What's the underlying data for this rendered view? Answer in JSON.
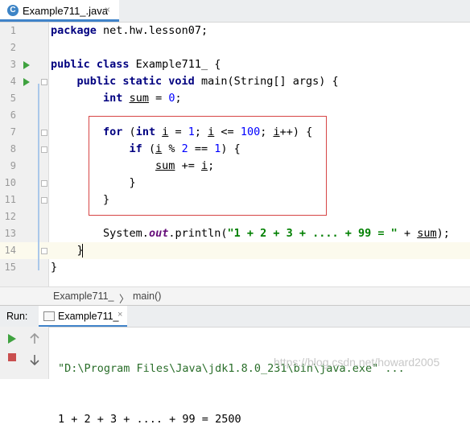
{
  "editor_tab": {
    "title": "Example711_.java",
    "icon": "C",
    "close": "×"
  },
  "editor": {
    "line_numbers": [
      "1",
      "2",
      "3",
      "4",
      "5",
      "6",
      "7",
      "8",
      "9",
      "10",
      "11",
      "12",
      "13",
      "14",
      "15"
    ],
    "code": {
      "l1_kw": "package",
      "l1_rest": " net.hw.lesson07;",
      "l3_kw": "public class",
      "l3_rest": " Example711_ {",
      "l4_kw": "public static void",
      "l4_rest": " main(String[] args) {",
      "l5_kw": "int",
      "l5_var": "sum",
      "l5_eq": " = ",
      "l5_num": "0",
      "l5_end": ";",
      "l7_for": "for",
      "l7_a": " (",
      "l7_int": "int",
      "l7_i1": "i",
      "l7_b": " = ",
      "l7_n1": "1",
      "l7_c": "; ",
      "l7_i2": "i",
      "l7_d": " <= ",
      "l7_n2": "100",
      "l7_e": "; ",
      "l7_i3": "i",
      "l7_f": "++) {",
      "l8_if": "if",
      "l8_a": " (",
      "l8_i": "i",
      "l8_b": " % ",
      "l8_n1": "2",
      "l8_c": " == ",
      "l8_n2": "1",
      "l8_d": ") {",
      "l9_sum": "sum",
      "l9_a": " += ",
      "l9_i": "i",
      "l9_b": ";",
      "l10": "}",
      "l11": "}",
      "l13_a": "System.",
      "l13_out": "out",
      "l13_b": ".println(",
      "l13_str": "\"1 + 2 + 3 + .... + 99 = \"",
      "l13_c": " + ",
      "l13_sum": "sum",
      "l13_d": ");",
      "l14": "}",
      "l15": "}"
    }
  },
  "breadcrumb": {
    "class": "Example711_",
    "sep": "〉",
    "method": "main()"
  },
  "run_panel": {
    "label": "Run:",
    "tab_title": "Example711_",
    "tab_close": "×",
    "output": [
      "\"D:\\Program Files\\Java\\jdk1.8.0_231\\bin\\java.exe\" ...",
      "1 + 2 + 3 + .... + 99 = 2500"
    ]
  },
  "watermark": "https://blog.csdn.net/howard2005",
  "colors": {
    "accent": "#4083c9",
    "run_green": "#3fa23f",
    "stop_red": "#c94f4f",
    "highlight_box": "#d64545"
  }
}
